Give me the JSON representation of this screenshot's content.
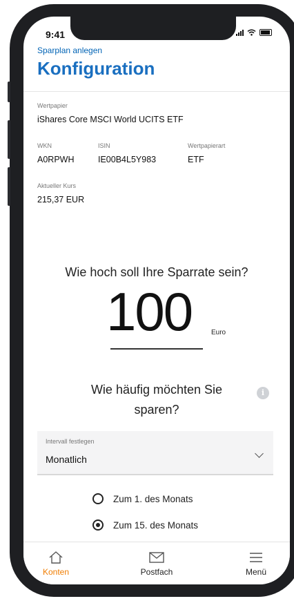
{
  "status_bar": {
    "time": "9:41"
  },
  "header": {
    "breadcrumb": "Sparplan anlegen",
    "title": "Konfiguration"
  },
  "security": {
    "label_name": "Wertpapier",
    "name": "iShares Core MSCI World UCITS ETF",
    "label_wkn": "WKN",
    "wkn": "A0RPWH",
    "label_isin": "ISIN",
    "isin": "IE00B4L5Y983",
    "label_type": "Wertpapierart",
    "type": "ETF",
    "label_price": "Aktueller Kurs",
    "price": "215,37 EUR"
  },
  "rate": {
    "question": "Wie hoch soll Ihre Sparrate sein?",
    "amount": "100",
    "currency": "Euro"
  },
  "frequency": {
    "question_line1": "Wie häufig möchten Sie",
    "question_line2": "sparen?",
    "dropdown_label": "Intervall festlegen",
    "dropdown_value": "Monatlich",
    "options": [
      {
        "label": "Zum 1. des Monats",
        "selected": false
      },
      {
        "label": "Zum 15. des Monats",
        "selected": true
      }
    ]
  },
  "tabbar": {
    "tabs": [
      {
        "label": "Konten",
        "icon": "home-icon",
        "active": true
      },
      {
        "label": "Postfach",
        "icon": "mail-icon",
        "active": false
      },
      {
        "label": "Menü",
        "icon": "menu-icon",
        "active": false
      }
    ]
  },
  "colors": {
    "accent_blue": "#1a6fc0",
    "active_orange": "#f07d00",
    "frame": "#1e1f22"
  }
}
